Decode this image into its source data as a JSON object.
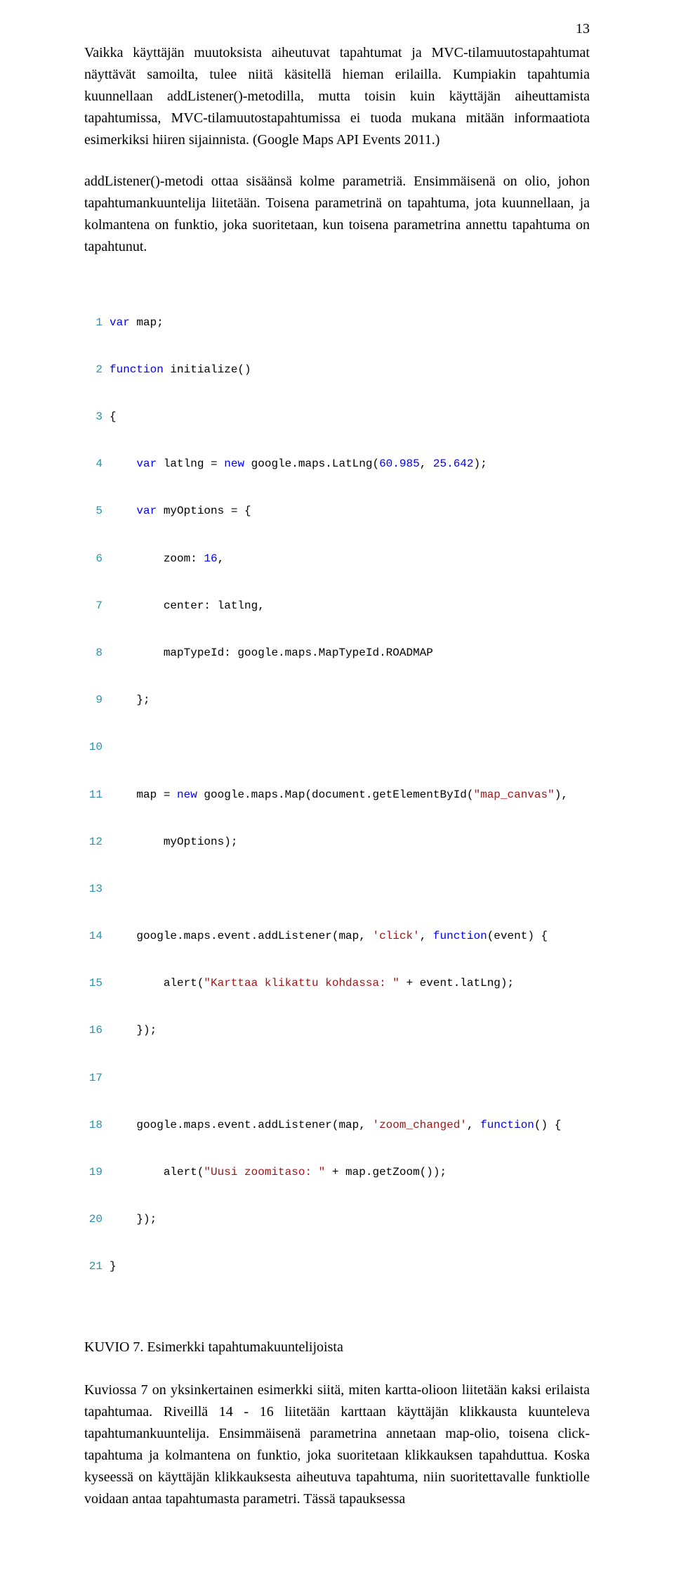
{
  "page_number": "13",
  "paragraphs": {
    "p1": "Vaikka käyttäjän muutoksista aiheutuvat tapahtumat ja MVC-tilamuutostapahtumat näyttävät samoilta, tulee niitä käsitellä hieman erilailla. Kumpiakin tapahtumia kuunnellaan addListener()-metodilla, mutta toisin kuin käyttäjän aiheuttamista tapahtumissa, MVC-tilamuutostapahtumissa ei tuoda mukana mitään informaatiota esimerkiksi hiiren sijainnista. (Google Maps API Events 2011.)",
    "p2": "addListener()-metodi ottaa sisäänsä kolme parametriä. Ensimmäisenä on olio, johon tapahtumankuuntelija liitetään. Toisena parametrinä on tapahtuma, jota kuunnellaan, ja kolmantena on funktio, joka suoritetaan, kun toisena parametrina annettu tapahtuma on tapahtunut.",
    "caption": "KUVIO 7. Esimerkki tapahtumakuuntelijoista",
    "p3": "Kuviossa 7 on yksinkertainen esimerkki siitä, miten kartta-olioon liitetään kaksi erilaista tapahtumaa. Riveillä 14 - 16 liitetään karttaan käyttäjän klikkausta kuunteleva tapahtumankuuntelija. Ensimmäisenä parametrina annetaan map-olio, toisena click-tapahtuma ja kolmantena on funktio, joka suoritetaan klikkauksen tapahduttua. Koska kyseessä on käyttäjän klikkauksesta aiheutuva tapahtuma, niin suoritettavalle funktiolle voidaan antaa tapahtumasta parametri. Tässä tapauksessa"
  },
  "code": {
    "l1": {
      "kw1": "var",
      "rest": " map;"
    },
    "l2": {
      "kw1": "function",
      "rest": " initialize()"
    },
    "l3": {
      "rest": "{"
    },
    "l4": {
      "indent": "    ",
      "kw1": "var",
      "mid": " latlng = ",
      "kw2": "new",
      "rest": " google.maps.LatLng(",
      "n1": "60.985",
      "c1": ", ",
      "n2": "25.642",
      "end": ");"
    },
    "l5": {
      "indent": "    ",
      "kw1": "var",
      "rest": " myOptions = {"
    },
    "l6": {
      "indent": "        ",
      "key": "zoom: ",
      "n1": "16",
      "end": ","
    },
    "l7": {
      "indent": "        ",
      "rest": "center: latlng,"
    },
    "l8": {
      "indent": "        ",
      "rest": "mapTypeId: google.maps.MapTypeId.ROADMAP"
    },
    "l9": {
      "indent": "    ",
      "rest": "};"
    },
    "l10": {
      "rest": ""
    },
    "l11": {
      "indent": "    ",
      "pre": "map = ",
      "kw1": "new",
      "mid": " google.maps.Map(document.getElementById(",
      "s1": "\"map_canvas\"",
      "end": "),"
    },
    "l12": {
      "indent": "        ",
      "rest": "myOptions);"
    },
    "l13": {
      "rest": ""
    },
    "l14": {
      "indent": "    ",
      "pre": "google.maps.event.addListener(map, ",
      "s1": "'click'",
      "mid": ", ",
      "kw1": "function",
      "end": "(event) {"
    },
    "l15": {
      "indent": "        ",
      "pre": "alert(",
      "s1": "\"Karttaa klikattu kohdassa: \"",
      "end": " + event.latLng);"
    },
    "l16": {
      "indent": "    ",
      "rest": "});"
    },
    "l17": {
      "rest": ""
    },
    "l18": {
      "indent": "    ",
      "pre": "google.maps.event.addListener(map, ",
      "s1": "'zoom_changed'",
      "mid": ", ",
      "kw1": "function",
      "end": "() {"
    },
    "l19": {
      "indent": "        ",
      "pre": "alert(",
      "s1": "\"Uusi zoomitaso: \"",
      "end": " + map.getZoom());"
    },
    "l20": {
      "indent": "    ",
      "rest": "});"
    },
    "l21": {
      "rest": "}"
    }
  },
  "line_numbers": [
    "1",
    "2",
    "3",
    "4",
    "5",
    "6",
    "7",
    "8",
    "9",
    "10",
    "11",
    "12",
    "13",
    "14",
    "15",
    "16",
    "17",
    "18",
    "19",
    "20",
    "21"
  ]
}
